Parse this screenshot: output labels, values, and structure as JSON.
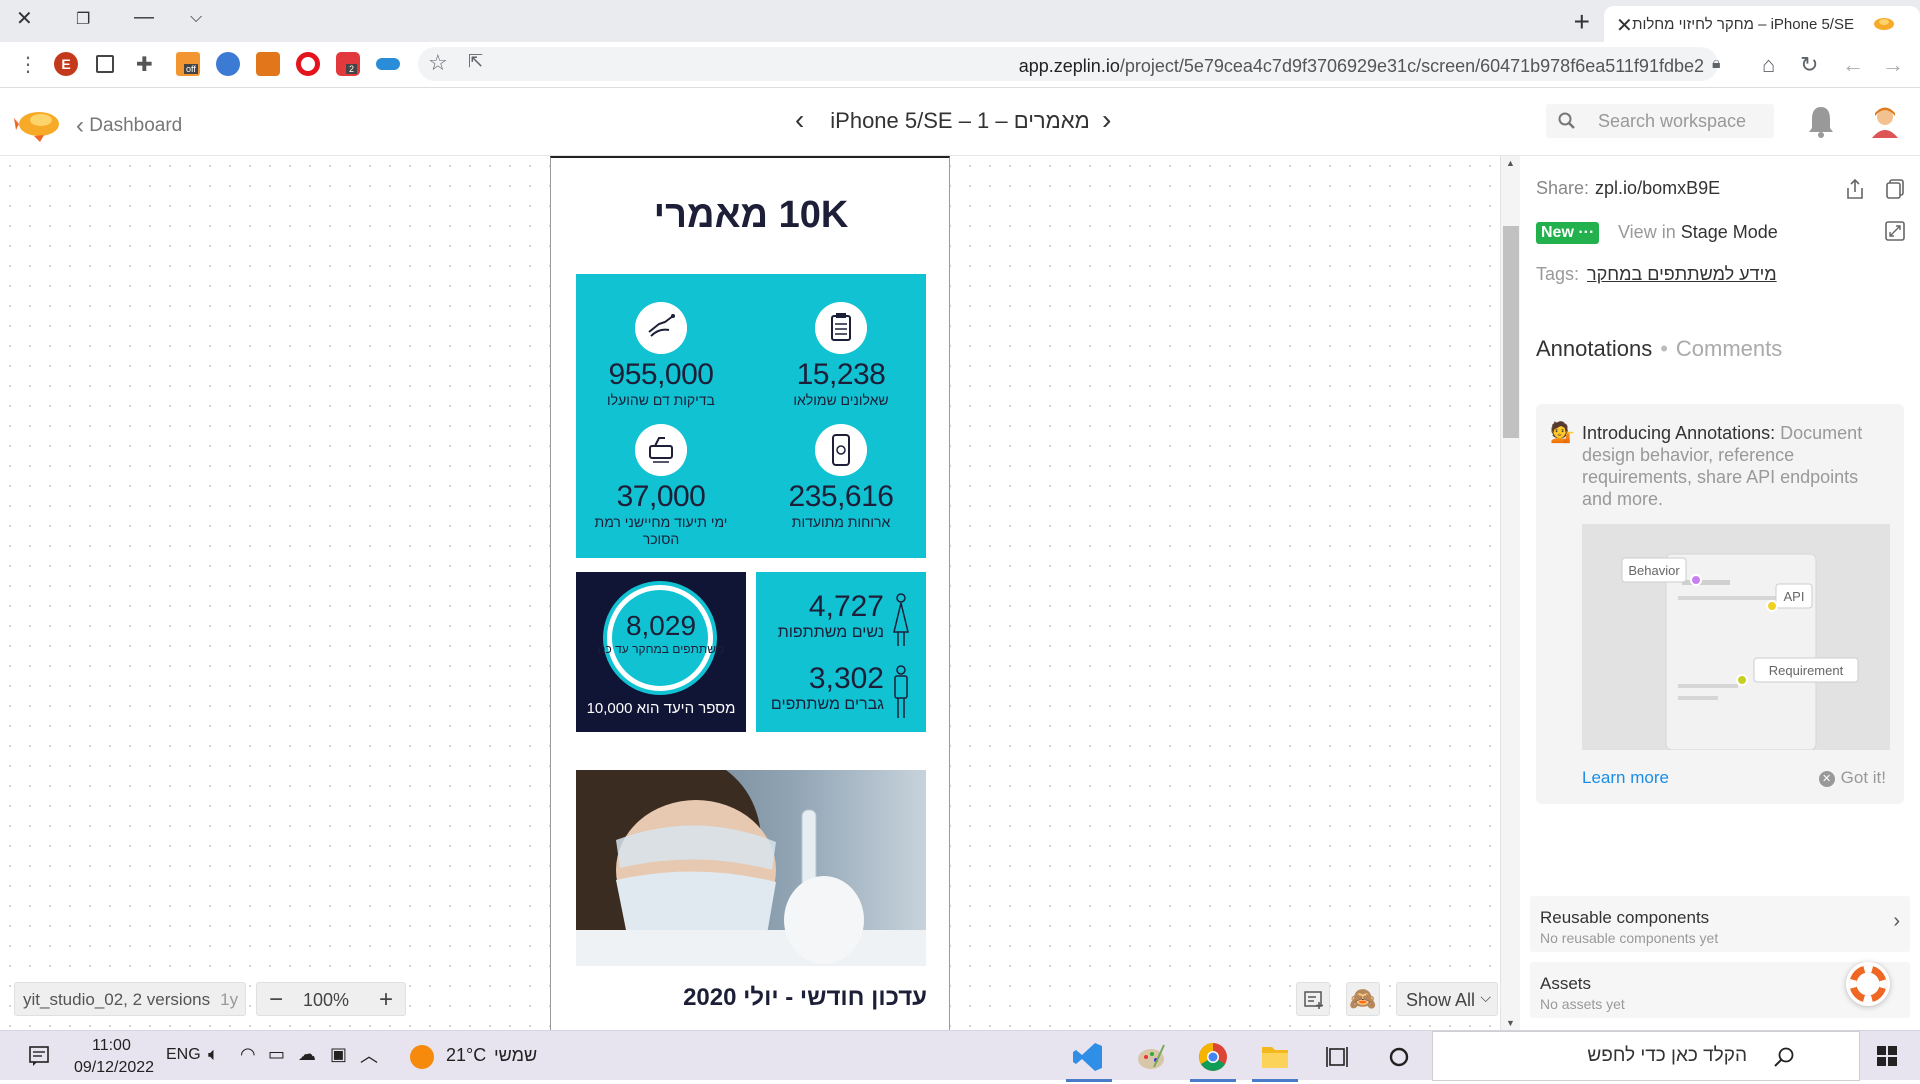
{
  "browser": {
    "tab_title": "iPhone 5/SE – מחקר לחיזוי מחלות",
    "url_host": "app.zeplin.io",
    "url_path": "/project/5e79cea4c7d9f3706929e31c/screen/60471b978f6ea511f91fdbe2",
    "ext_badge_off": "off",
    "ext_badge_abp": "2",
    "profile_initial": "E"
  },
  "header": {
    "back_label": "Dashboard",
    "screen_title": "iPhone 5/SE – 1 – מאמרים",
    "search_placeholder": "Search workspace"
  },
  "artboard": {
    "title": "10K מאמרי",
    "stats": [
      {
        "value": "15,238",
        "label": "שאלונים שמולאו",
        "icon": "clipboard-icon"
      },
      {
        "value": "955,000",
        "label": "בדיקות דם שהועלו",
        "icon": "blood-test-icon"
      },
      {
        "value": "235,616",
        "label": "ארוחות מתועדות",
        "icon": "phone-meal-icon"
      },
      {
        "value": "37,000",
        "label": "ימי תיעוד מחיישני רמת הסוכר",
        "icon": "glucose-sensor-icon"
      }
    ],
    "participants": {
      "value": "8,029",
      "label": "משתתפים במחקר עד כה",
      "goal": "מספר היעד הוא 10,000"
    },
    "gender": {
      "women_value": "4,727",
      "women_label": "נשים משתתפות",
      "men_value": "3,302",
      "men_label": "גברים משתתפים"
    },
    "section_title": "עדכון חודשי - יולי 2020"
  },
  "canvas_controls": {
    "version_name": "yit_studio_02, 2 versions",
    "version_age": "1y",
    "zoom_minus": "−",
    "zoom_value": "100%",
    "zoom_plus": "+",
    "show_all": "Show All"
  },
  "sidebar": {
    "share_label": "Share:",
    "share_link": "zpl.io/bomxB9E",
    "new_badge": "New ···",
    "view_in": "View in",
    "stage_mode": "Stage Mode",
    "tags_label": "Tags:",
    "tag_value": "מידע למשתתפים במחקר",
    "tab_annotations": "Annotations",
    "tab_separator": "•",
    "tab_comments": "Comments",
    "intro_title": "Introducing Annotations:",
    "intro_body": "Document design behavior, reference requirements, share API endpoints and more.",
    "intro_tag_behavior": "Behavior",
    "intro_tag_api": "API",
    "intro_tag_requirement": "Requirement",
    "learn_more": "Learn more",
    "got_it": "Got it!",
    "reusable_title": "Reusable components",
    "reusable_sub": "No reusable components yet",
    "assets_title": "Assets",
    "assets_sub": "No assets yet"
  },
  "taskbar": {
    "time": "11:00",
    "date": "09/12/2022",
    "lang": "ENG",
    "temperature": "21°C",
    "weather": "שמשי",
    "search_placeholder": "הקלד כאן כדי לחפש"
  },
  "colors": {
    "accent_cyan": "#11c2d3",
    "navy": "#111535",
    "zeplin_orange": "#f7a928",
    "new_green": "#23b14d",
    "link_blue": "#1a8ee6"
  }
}
